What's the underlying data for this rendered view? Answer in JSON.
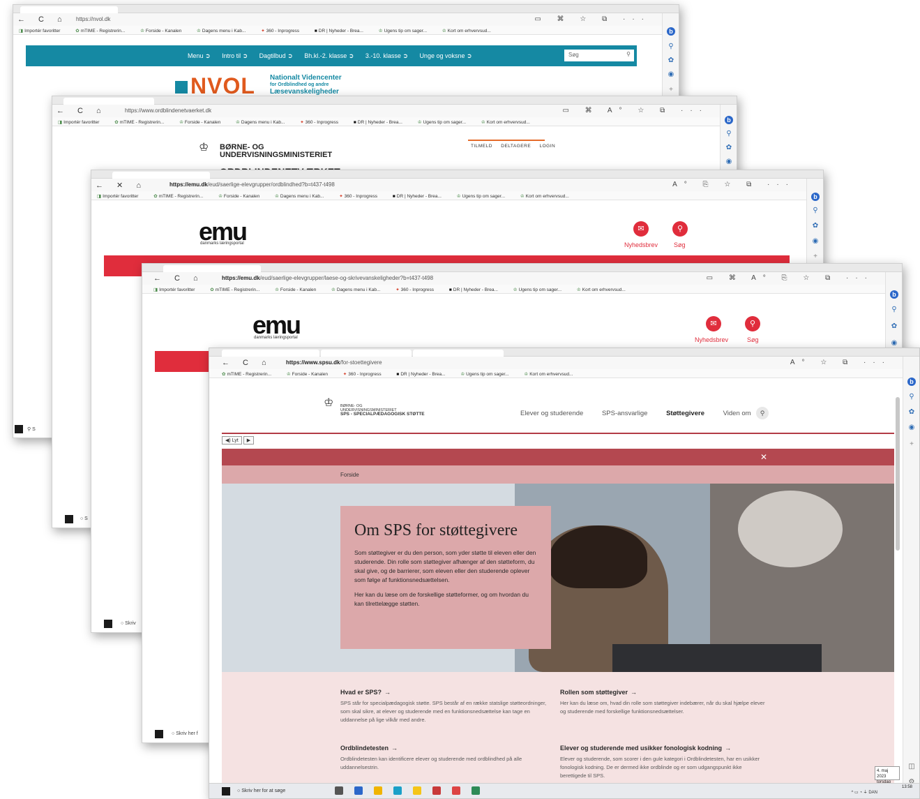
{
  "w1": {
    "url": "https://nvol.dk",
    "nav": [
      "Menu ➲",
      "Intro til ➲",
      "Dagtilbud ➲",
      "Bh.kl.-2. klasse ➲",
      "3.-10. klasse ➲",
      "Unge og voksne ➲"
    ],
    "search_placeholder": "Søg",
    "logo": "NVOL",
    "logo_sub1": "Nationalt Videncenter",
    "logo_sub2": "for Ordblindhed og andre",
    "logo_sub3": "Læsevanskeligheder"
  },
  "favorites": [
    "Importér favoritter",
    "mTIME - Registrerin...",
    "Forside - Kanalen",
    "Dagens menu i Kab...",
    "360 - Inprogress",
    "DR | Nyheder - Brea...",
    "Ugens tip om sager...",
    "Kort om erhvervsud..."
  ],
  "w2": {
    "url": "https://www.ordblindenetvaerket.dk",
    "ministry1": "BØRNE- OG",
    "ministry2": "UNDERVISNINGSMINISTERIET",
    "links": [
      "TILMELD",
      "DELTAGERE",
      "LOGIN"
    ],
    "title": "ORDBLINDENETVÆRKET"
  },
  "w3": {
    "url_host": "https://emu.dk",
    "url_path": "/eud/saerlige-elevgrupper/ordblindhed?b=t437-t498",
    "logo": "emu",
    "logo_sub": "danmarks læringsportal",
    "newsletter": "Nyhedsbrev",
    "search": "Søg"
  },
  "w4": {
    "url_host": "https://emu.dk",
    "url_path": "/eud/saerlige-elevgrupper/laese-og-skrivevanskeligheder?b=t437-t498",
    "logo": "emu",
    "logo_sub": "danmarks læringsportal",
    "newsletter": "Nyhedsbrev",
    "search": "Søg"
  },
  "w5": {
    "url_host": "https://www.spsu.dk",
    "url_path": "/for-stoettegivere",
    "ministry1": "BØRNE- OG",
    "ministry2": "UNDERVISNINGSMINISTERIET",
    "ministry3": "SPS - SPECIALPÆDAGOGISK STØTTE",
    "nav": [
      "Elever og studerende",
      "SPS-ansvarlige",
      "Støttegivere",
      "Viden om"
    ],
    "lyt": "◀) Lyt",
    "breadcrumb": "Forside",
    "hero_title": "Om SPS for støttegivere",
    "hero_p1": "Som støttegiver er du den person, som yder støtte til eleven eller den studerende. Din rolle som støttegiver afhænger af den støtteform, du skal give, og de barrierer, som eleven eller den studerende oplever som følge af funktionsnedsættelsen.",
    "hero_p2": "Her kan du læse om de forskellige støtteformer, og om hvordan du kan tilrettelægge støtten.",
    "links": [
      {
        "title": "Hvad er SPS?",
        "text": "SPS står for specialpædagogisk støtte. SPS består af en række statslige støtteordninger, som skal sikre, at elever og studerende med en funktionsnedsættelse kan tage en uddannelse på lige vilkår med andre."
      },
      {
        "title": "Rollen som støttegiver",
        "text": "Her kan du læse om, hvad din rolle som støttegiver indebærer, når du skal hjælpe elever og studerende med forskellige funktionsnedsættelser."
      },
      {
        "title": "Ordblindetesten",
        "text": "Ordblindetesten kan identificere elever og studerende med ordblindhed på alle uddannelsestrin."
      },
      {
        "title": "Elever og studerende med usikker fonologisk kodning",
        "text": "Elever og studerende, som scorer i den gule kategori i Ordblindetesten, har en usikker fonologisk kodning. De er dermed ikke ordblinde og er som udgangspunkt ikke berettigede til SPS."
      }
    ],
    "taskbar_search": "Skriv her for at søge",
    "clock_date": "4. maj 2023",
    "clock_day": "torsdag",
    "clock_time": "13:58",
    "lang": "DAN"
  },
  "taskbar_search_short": "Skriv her f",
  "colors": {
    "nvol_teal": "#1589a3",
    "emu_red": "#e02d3c",
    "sps_red": "#b44850",
    "sps_pink": "#dca8aa"
  }
}
